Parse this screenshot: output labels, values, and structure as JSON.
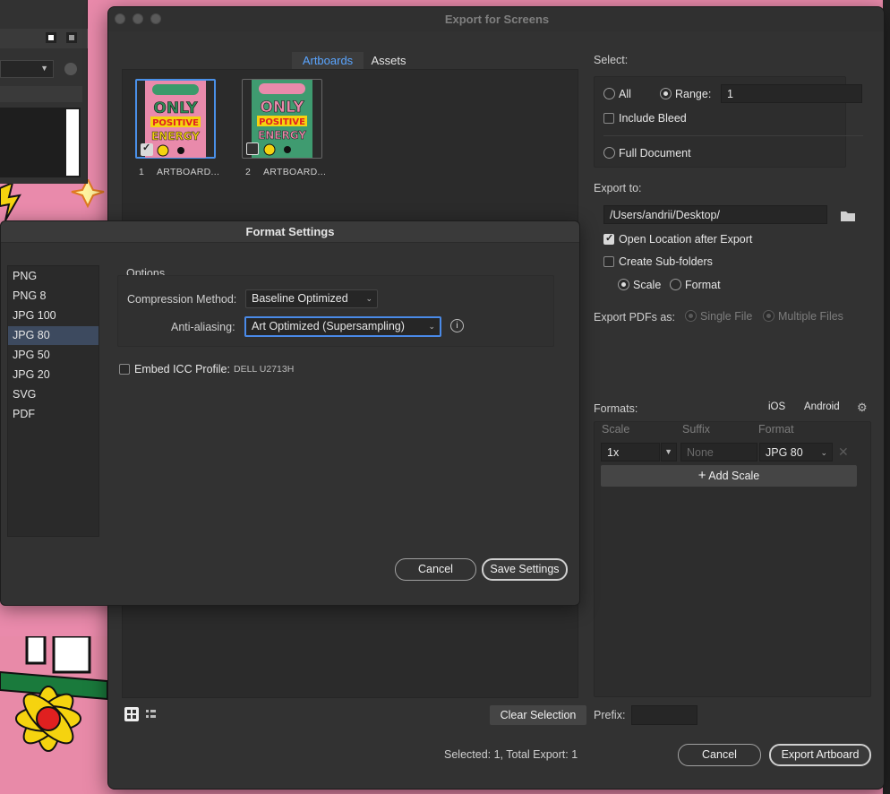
{
  "dialog": {
    "title": "Export for Screens",
    "tabs": [
      {
        "label": "Artboards"
      },
      {
        "label": "Assets"
      }
    ],
    "artboards": [
      {
        "number": "1",
        "name": "ARTBOARD...",
        "art_text": "ONLY POSITIVE ENERGY",
        "checked": true
      },
      {
        "number": "2",
        "name": "ARTBOARD...",
        "art_text": "ONLY POSITIVE ENERGY",
        "checked": false
      }
    ],
    "select": {
      "label": "Select:",
      "all_label": "All",
      "range_label": "Range:",
      "range_value": "1",
      "include_bleed_label": "Include Bleed",
      "full_document_label": "Full Document"
    },
    "export_to": {
      "label": "Export to:",
      "path": "/Users/andrii/Desktop/",
      "open_location_label": "Open Location after Export",
      "create_subfolders_label": "Create Sub-folders",
      "scale_label": "Scale",
      "format_label": "Format",
      "export_pdfs_label": "Export PDFs as:",
      "single_file_label": "Single File",
      "multiple_files_label": "Multiple Files"
    },
    "formats": {
      "label": "Formats:",
      "ios_label": "iOS",
      "android_label": "Android",
      "col_scale": "Scale",
      "col_suffix": "Suffix",
      "col_format": "Format",
      "row": {
        "scale": "1x",
        "suffix_placeholder": "None",
        "format": "JPG 80"
      },
      "add_scale_label": "Add Scale"
    },
    "footer": {
      "clear_selection_label": "Clear Selection",
      "prefix_label": "Prefix:",
      "prefix_value": "",
      "status": "Selected: 1, Total Export: 1",
      "cancel_label": "Cancel",
      "export_label": "Export Artboard"
    }
  },
  "format_settings": {
    "title": "Format Settings",
    "formats": [
      "PNG",
      "PNG 8",
      "JPG 100",
      "JPG 80",
      "JPG 50",
      "JPG 20",
      "SVG",
      "PDF"
    ],
    "selected_format": "JPG 80",
    "options_label": "Options",
    "compression_label": "Compression Method:",
    "compression_value": "Baseline Optimized",
    "antialiasing_label": "Anti-aliasing:",
    "antialiasing_value": "Art Optimized (Supersampling)",
    "embed_icc_label": "Embed ICC Profile:",
    "icc_profile": "DELL U2713H",
    "cancel_label": "Cancel",
    "save_label": "Save Settings"
  },
  "colors": {
    "accent_blue": "#5aa5ff",
    "selection": "#3d4a5f",
    "dialog_bg": "#323232",
    "art_pink": "#e98aab",
    "art_green": "#3a9a6a",
    "art_yellow": "#f5d30f"
  }
}
